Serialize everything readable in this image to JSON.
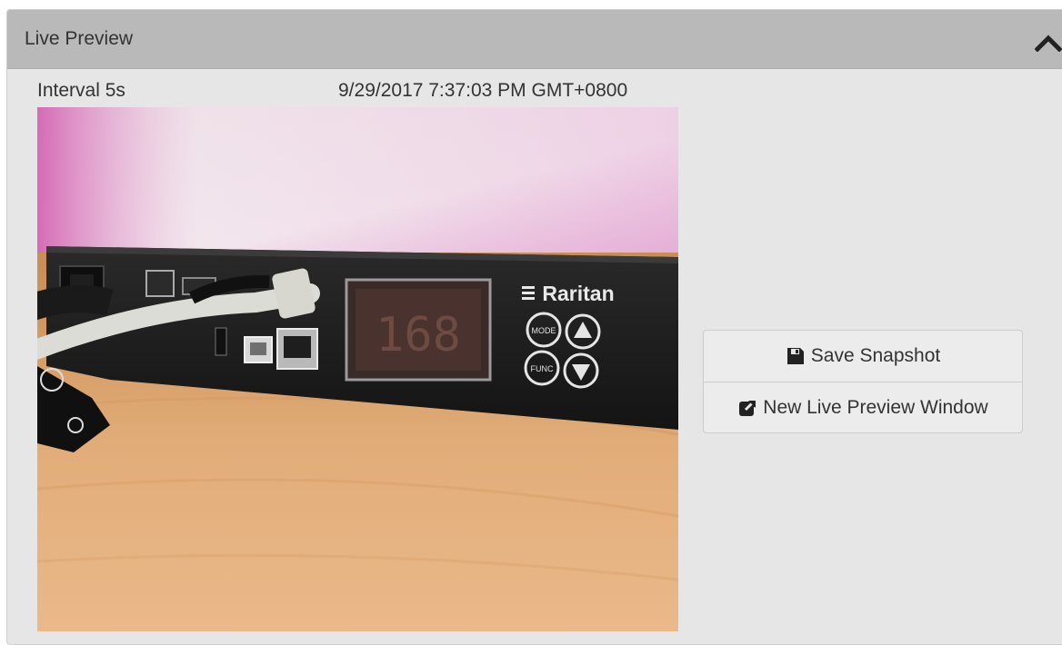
{
  "panel": {
    "title": "Live Preview"
  },
  "preview": {
    "interval_label": "Interval 5s",
    "timestamp": "9/29/2017 7:37:03 PM GMT+0800",
    "device_brand": "Raritan",
    "display_digits": "168",
    "button_mode": "MODE",
    "button_func": "FUNC"
  },
  "actions": {
    "save_snapshot": "Save Snapshot",
    "new_window": "New Live Preview Window"
  },
  "icons": {
    "collapse": "chevron-up-icon",
    "save": "floppy-disk-icon",
    "external": "external-link-icon"
  }
}
